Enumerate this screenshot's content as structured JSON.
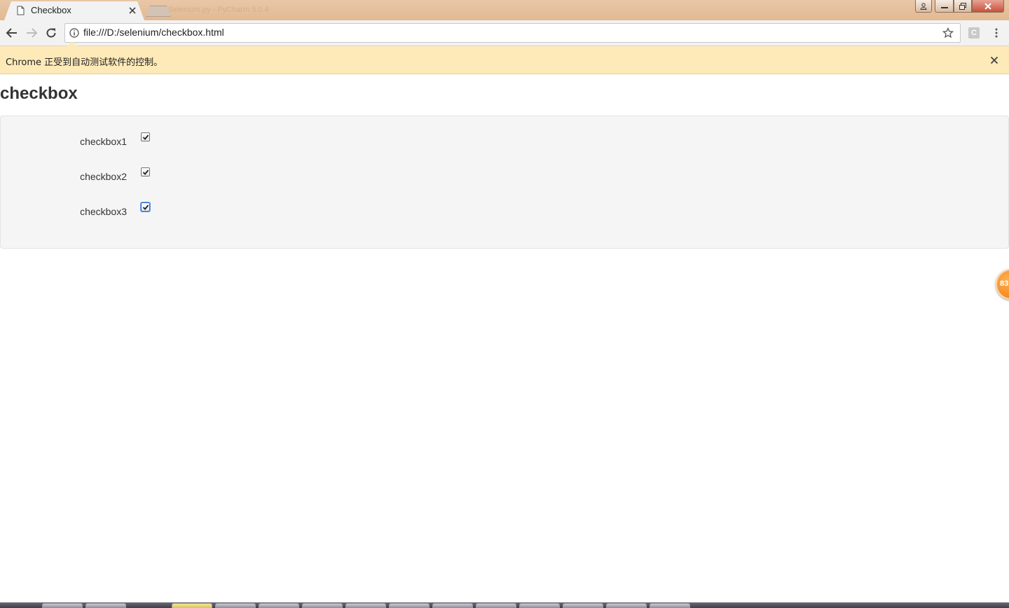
{
  "browser": {
    "tab_title": "Checkbox",
    "background_tab_title": "Selenium.py - PyCharm 5.0.4",
    "url": "file:///D:/selenium/checkbox.html",
    "extension_letter": "C",
    "infobar_text": "Chrome 正受到自动测试软件的控制。"
  },
  "page": {
    "title": "checkbox",
    "checkboxes": [
      {
        "label": "checkbox1",
        "checked": true,
        "focused": false
      },
      {
        "label": "checkbox2",
        "checked": true,
        "focused": false
      },
      {
        "label": "checkbox3",
        "checked": true,
        "focused": true
      }
    ]
  },
  "badge": {
    "text": "83"
  },
  "colors": {
    "titlebar": "#e2b993",
    "infobar": "#feeab8",
    "well": "#f5f5f5",
    "badge": "#f07a0c"
  }
}
